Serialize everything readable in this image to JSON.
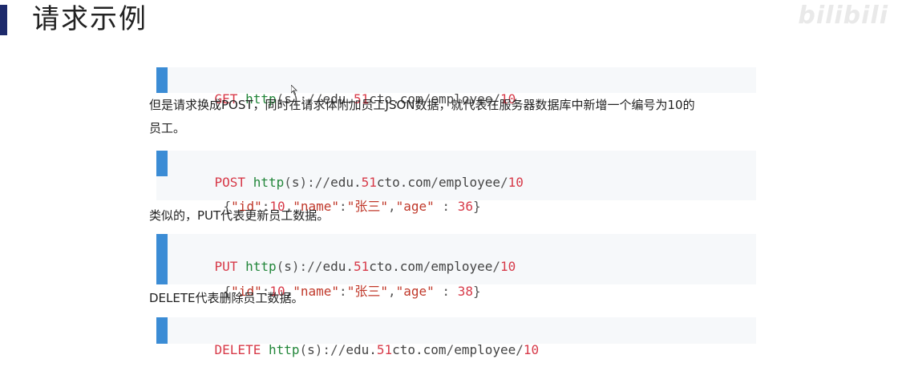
{
  "title": "请求示例",
  "watermark": "bilibili",
  "blocks": [
    {
      "method": "GET",
      "scheme": "http",
      "paren_open": "(",
      "s": "s",
      "paren_close": ")",
      "sep": "://",
      "host1": "edu.",
      "host_num": "51",
      "host2": "cto.com",
      "slash1": "/",
      "path": "employee",
      "slash2": "/",
      "id": "10"
    },
    {
      "method": "POST",
      "scheme": "http",
      "paren_open": "(",
      "s": "s",
      "paren_close": ")",
      "sep": "://",
      "host1": "edu.",
      "host_num": "51",
      "host2": "cto.com",
      "slash1": "/",
      "path": "employee",
      "slash2": "/",
      "id": "10",
      "body": {
        "lb": "{",
        "k_id": "\"id\"",
        "c1": ":",
        "v_id": "10",
        "comma1": ",",
        "k_name": "\"name\"",
        "c2": ":",
        "v_name": "\"张三\"",
        "comma2": ",",
        "k_age": "\"age\"",
        "c3": " : ",
        "v_age": "36",
        "rb": "}"
      }
    },
    {
      "method": "PUT",
      "scheme": "http",
      "paren_open": "(",
      "s": "s",
      "paren_close": ")",
      "sep": "://",
      "host1": "edu.",
      "host_num": "51",
      "host2": "cto.com",
      "slash1": "/",
      "path": "employee",
      "slash2": "/",
      "id": "10",
      "body": {
        "lb": "{",
        "k_id": "\"id\"",
        "c1": ":",
        "v_id": "10",
        "comma1": ",",
        "k_name": "\"name\"",
        "c2": ":",
        "v_name": "\"张三\"",
        "comma2": ",",
        "k_age": "\"age\"",
        "c3": " : ",
        "v_age": "38",
        "rb": "}"
      }
    },
    {
      "method": "DELETE",
      "scheme": "http",
      "paren_open": "(",
      "s": "s",
      "paren_close": ")",
      "sep": "://",
      "host1": "edu.",
      "host_num": "51",
      "host2": "cto.com",
      "slash1": "/",
      "path": "employee",
      "slash2": "/",
      "id": "10"
    }
  ],
  "paragraphs": {
    "p1_line1": "但是请求换成POST，同时在请求体附加员工JSON数据，就代表在服务器数据库中新增一个编号为10的",
    "p1_line2": "员工。",
    "p2": "类似的，PUT代表更新员工数据。",
    "p3": "DELETE代表删除员工数据。"
  },
  "colors": {
    "accent_bar": "#3b8cd5",
    "title_bar": "#1d2a6b",
    "method": "#d73a49",
    "keyword": "#22863a"
  }
}
